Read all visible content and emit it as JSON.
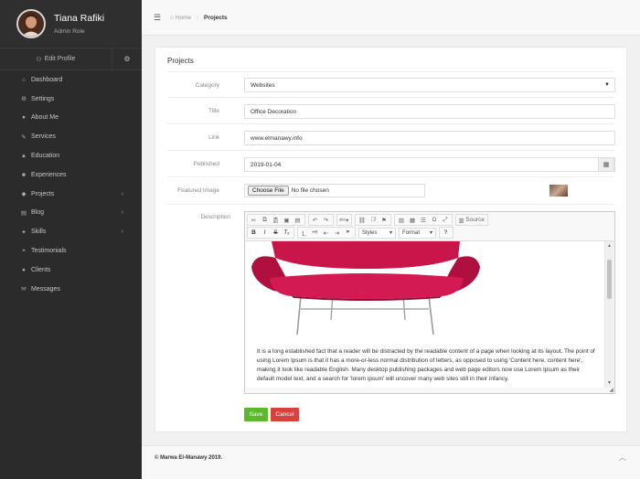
{
  "sidebar": {
    "user_name": "Tiana Rafiki",
    "user_role": "Admin Role",
    "edit_profile": "Edit Profile",
    "items": [
      {
        "label": "Dashboard",
        "icon": "home-icon",
        "glyph": "⌂"
      },
      {
        "label": "Settings",
        "icon": "cogs-icon",
        "glyph": "⚙"
      },
      {
        "label": "About Me",
        "icon": "user-icon",
        "glyph": "●"
      },
      {
        "label": "Services",
        "icon": "wrench-icon",
        "glyph": "✎"
      },
      {
        "label": "Education",
        "icon": "graduation-cap-icon",
        "glyph": "▲"
      },
      {
        "label": "Experiences",
        "icon": "briefcase-icon",
        "glyph": "■"
      },
      {
        "label": "Projects",
        "icon": "tags-icon",
        "glyph": "◆",
        "has_children": true
      },
      {
        "label": "Blog",
        "icon": "newspaper-icon",
        "glyph": "▤",
        "has_children": true
      },
      {
        "label": "Skills",
        "icon": "magic-icon",
        "glyph": "✦",
        "has_children": true
      },
      {
        "label": "Testimonials",
        "icon": "comments-icon",
        "glyph": "❝"
      },
      {
        "label": "Clients",
        "icon": "users-icon",
        "glyph": "●"
      },
      {
        "label": "Messages",
        "icon": "envelope-icon",
        "glyph": "✉"
      }
    ]
  },
  "topbar": {
    "home": "Home",
    "current": "Projects"
  },
  "form": {
    "title": "Projects",
    "category_label": "Category",
    "category_value": "Websites",
    "title_label": "Title",
    "title_value": "Office Decoration",
    "link_label": "Link",
    "link_value": "www.elmanawy.info",
    "published_label": "Published",
    "published_value": "2019-01-04",
    "featured_label": "Featured Image",
    "choose_file": "Choose File",
    "no_file": "No file chosen",
    "description_label": "Description",
    "save": "Save",
    "cancel": "Cancel"
  },
  "editor": {
    "source_label": "Source",
    "styles_label": "Styles",
    "format_label": "Format",
    "body_text": "It is a long established fact that a reader will be distracted by the readable content of a page when looking at its layout. The point of using Lorem Ipsum is that it has a more-or-less normal distribution of letters, as opposed to using 'Content here, content here', making it look like readable English. Many desktop publishing packages and web page editors now use Lorem Ipsum as their default model text, and a search for 'lorem ipsum' will uncover many web sites still in their infancy."
  },
  "footer": {
    "copyright": "© Marwa El-Manawy 2019."
  },
  "colors": {
    "sidebar_bg": "#2b2b2b",
    "save_green": "#5cb82c",
    "cancel_red": "#d9413d",
    "sofa_magenta": "#c8154a"
  }
}
